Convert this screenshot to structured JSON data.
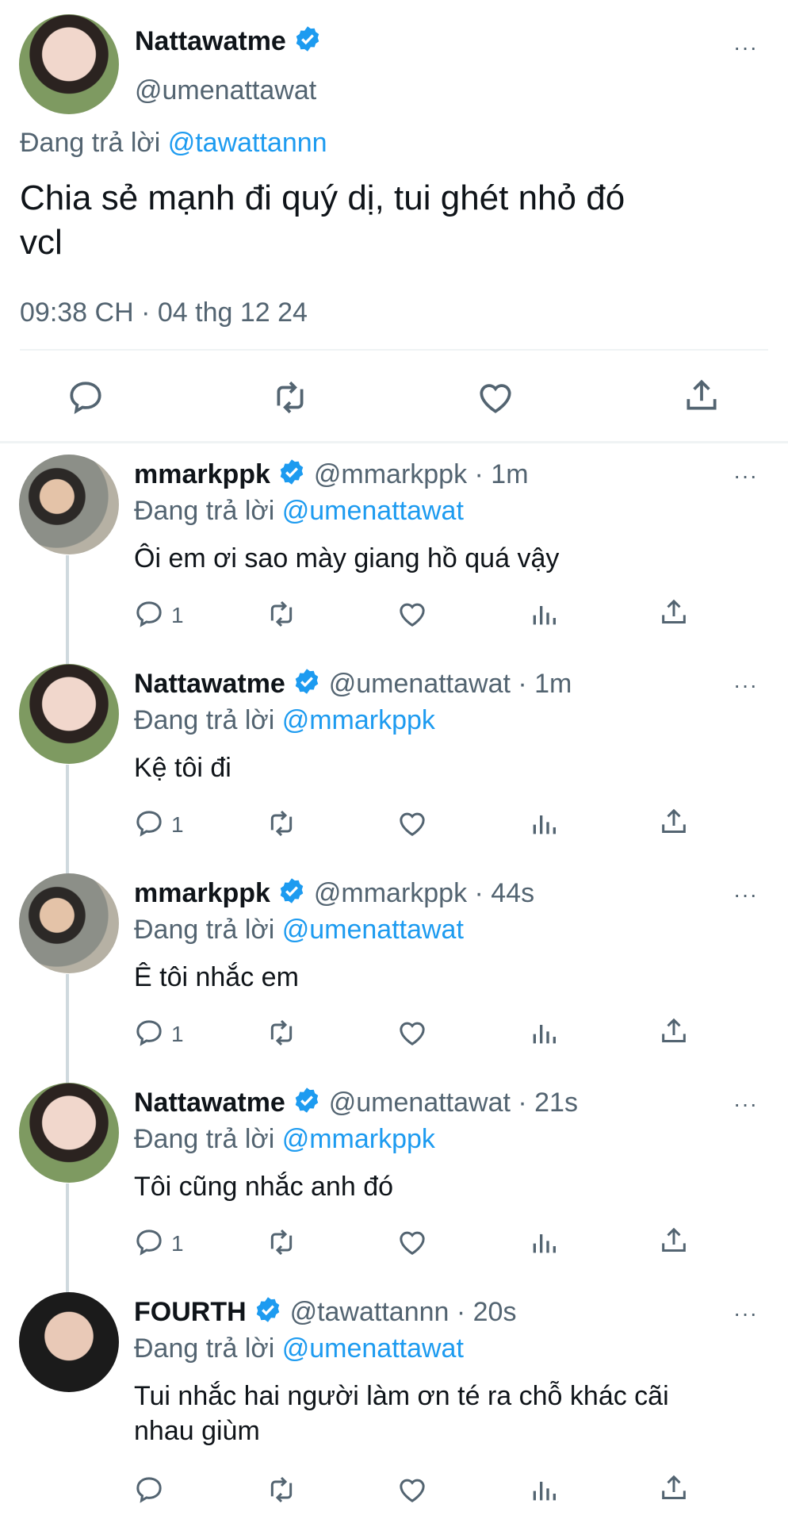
{
  "main_tweet": {
    "name": "Nattawatme",
    "handle": "@umenattawat",
    "replying_label": "Đang trả lời",
    "replying_to": "@tawattannn",
    "text_line1": "Chia sẻ mạnh đi quý dị, tui ghét nhỏ đó",
    "text_line2": "vcl",
    "timestamp": "09:38 CH · 04 thg 12 24",
    "more": "···"
  },
  "replies": [
    {
      "name": "mmarkppk",
      "handle": "@mmarkppk · 1m",
      "replying_label": "Đang trả lời",
      "replying_to": "@umenattawat",
      "text": "Ôi em ơi sao mày giang hồ quá vậy",
      "reply_count": "1",
      "more": "···"
    },
    {
      "name": "Nattawatme",
      "handle": "@umenattawat · 1m",
      "replying_label": "Đang trả lời",
      "replying_to": "@mmarkppk",
      "text": "Kệ tôi đi",
      "reply_count": "1",
      "more": "···"
    },
    {
      "name": "mmarkppk",
      "handle": "@mmarkppk · 44s",
      "replying_label": "Đang trả lời",
      "replying_to": "@umenattawat",
      "text": "Ê tôi nhắc em",
      "reply_count": "1",
      "more": "···"
    },
    {
      "name": "Nattawatme",
      "handle": "@umenattawat · 21s",
      "replying_label": "Đang trả lời",
      "replying_to": "@mmarkppk",
      "text": "Tôi cũng nhắc anh đó",
      "reply_count": "1",
      "more": "···"
    },
    {
      "name": "FOURTH",
      "handle": "@tawattannn · 20s",
      "replying_label": "Đang trả lời",
      "replying_to": "@umenattawat",
      "text_line1": "Tui nhắc hai người làm ơn té ra chỗ khác cãi",
      "text_line2": "nhau giùm",
      "reply_count": "",
      "more": "···"
    }
  ],
  "colors": {
    "accent": "#1d9bf0",
    "text": "#0f1419",
    "secondary": "#536471",
    "divider": "#eff3f4"
  }
}
